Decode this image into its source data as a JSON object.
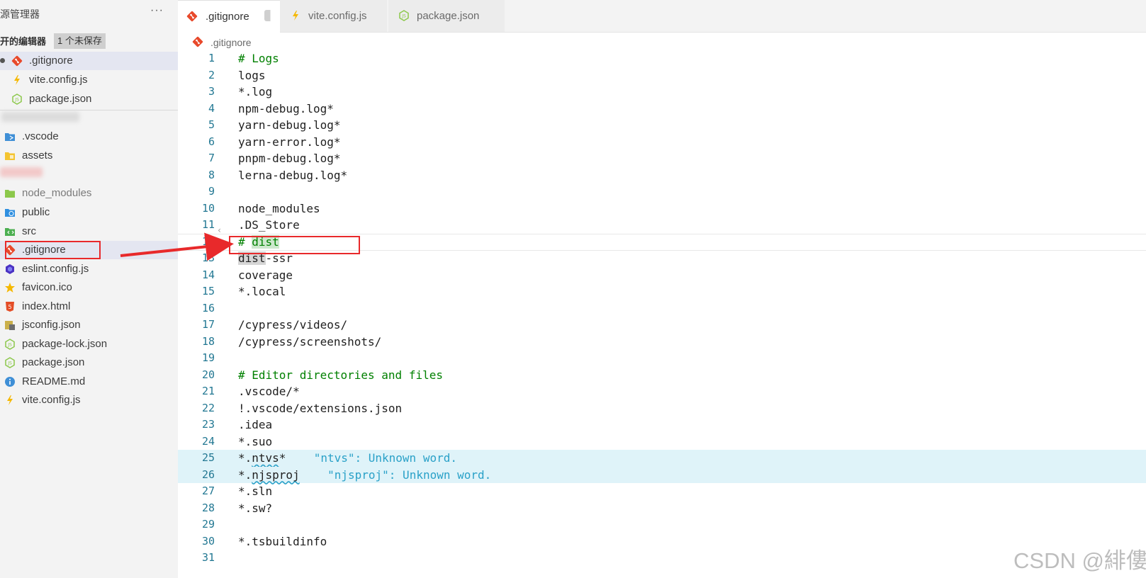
{
  "sidebar": {
    "title": "源管理器",
    "more": "···",
    "open_editors_label": "开的编辑器",
    "unsaved_badge": "1 个未保存",
    "open_editors": [
      {
        "label": ".gitignore",
        "icon": "git-icon",
        "active": true,
        "modified": true
      },
      {
        "label": "vite.config.js",
        "icon": "vite-icon"
      },
      {
        "label": "package.json",
        "icon": "nodejs-icon"
      }
    ],
    "files": [
      {
        "label": ".vscode",
        "icon": "vscode-folder-icon"
      },
      {
        "label": "assets",
        "icon": "assets-folder-icon"
      },
      {
        "label": "node_modules",
        "icon": "node-folder-icon",
        "dim": true
      },
      {
        "label": "public",
        "icon": "public-folder-icon"
      },
      {
        "label": "src",
        "icon": "src-folder-icon"
      },
      {
        "label": ".gitignore",
        "icon": "git-icon",
        "active": true
      },
      {
        "label": "eslint.config.js",
        "icon": "eslint-icon"
      },
      {
        "label": "favicon.ico",
        "icon": "star-icon"
      },
      {
        "label": "index.html",
        "icon": "html5-icon"
      },
      {
        "label": "jsconfig.json",
        "icon": "jsconfig-icon"
      },
      {
        "label": "package-lock.json",
        "icon": "nodejs-icon"
      },
      {
        "label": "package.json",
        "icon": "nodejs-icon"
      },
      {
        "label": "README.md",
        "icon": "info-icon"
      },
      {
        "label": "vite.config.js",
        "icon": "vite-icon"
      }
    ]
  },
  "tabs": [
    {
      "label": ".gitignore",
      "icon": "git-icon",
      "active": true
    },
    {
      "label": "vite.config.js",
      "icon": "vite-icon"
    },
    {
      "label": "package.json",
      "icon": "nodejs-icon"
    }
  ],
  "breadcrumb": {
    "label": ".gitignore",
    "icon": "git-icon"
  },
  "editor": {
    "lines": [
      {
        "n": "1",
        "text": "# Logs",
        "comment": true
      },
      {
        "n": "2",
        "text": "logs"
      },
      {
        "n": "3",
        "text": "*.log"
      },
      {
        "n": "4",
        "text": "npm-debug.log*"
      },
      {
        "n": "5",
        "text": "yarn-debug.log*"
      },
      {
        "n": "6",
        "text": "yarn-error.log*"
      },
      {
        "n": "7",
        "text": "pnpm-debug.log*"
      },
      {
        "n": "8",
        "text": "lerna-debug.log*"
      },
      {
        "n": "9",
        "text": ""
      },
      {
        "n": "10",
        "text": "node_modules"
      },
      {
        "n": "11",
        "text": ".DS_Store"
      },
      {
        "n": "12",
        "text": "# dist",
        "comment": true
      },
      {
        "n": "13",
        "text": "dist-ssr"
      },
      {
        "n": "14",
        "text": "coverage"
      },
      {
        "n": "15",
        "text": "*.local"
      },
      {
        "n": "16",
        "text": ""
      },
      {
        "n": "17",
        "text": "/cypress/videos/"
      },
      {
        "n": "18",
        "text": "/cypress/screenshots/"
      },
      {
        "n": "19",
        "text": ""
      },
      {
        "n": "20",
        "text": "# Editor directories and files",
        "comment": true
      },
      {
        "n": "21",
        "text": ".vscode/*"
      },
      {
        "n": "22",
        "text": "!.vscode/extensions.json"
      },
      {
        "n": "23",
        "text": ".idea"
      },
      {
        "n": "24",
        "text": "*.suo"
      },
      {
        "n": "25",
        "text": "*.ntvs*",
        "diag": "\"ntvs\": Unknown word.",
        "highlight": true
      },
      {
        "n": "26",
        "text": "*.njsproj",
        "diag": "\"njsproj\": Unknown word.",
        "highlight": true
      },
      {
        "n": "27",
        "text": "*.sln"
      },
      {
        "n": "28",
        "text": "*.sw?"
      },
      {
        "n": "29",
        "text": ""
      },
      {
        "n": "30",
        "text": "*.tsbuildinfo"
      },
      {
        "n": "31",
        "text": ""
      }
    ]
  },
  "watermark": "CSDN @緋僂",
  "colors": {
    "comment": "#008000",
    "line_number": "#237893",
    "annotation_red": "#e8292b",
    "diagnostic": "#2aa1c8",
    "selection": "#e4e6f1"
  }
}
